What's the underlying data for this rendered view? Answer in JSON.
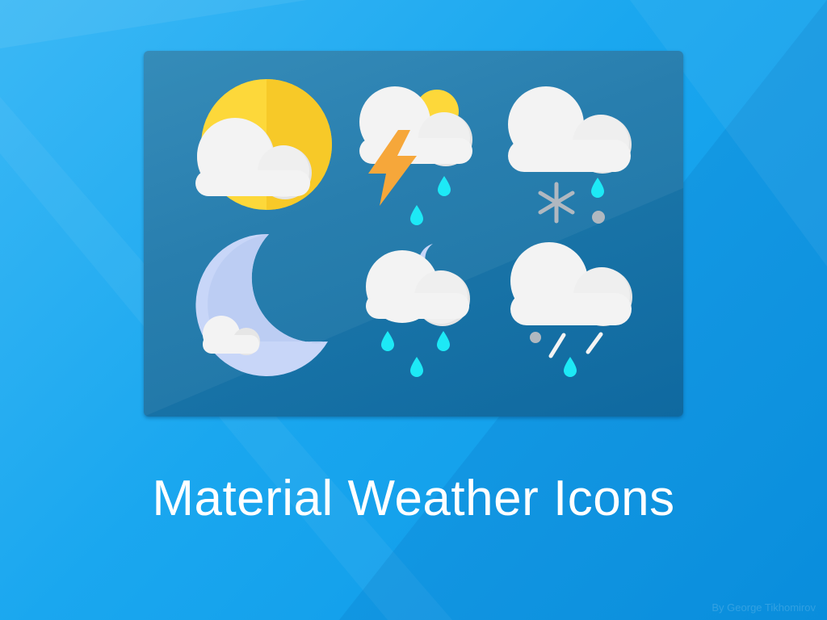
{
  "title": "Material Weather Icons",
  "credit": "By George Tikhomirov",
  "icons": [
    {
      "name": "partly-cloudy-day-icon"
    },
    {
      "name": "thunderstorm-rain-icon"
    },
    {
      "name": "snow-rain-icon"
    },
    {
      "name": "partly-cloudy-night-icon"
    },
    {
      "name": "night-rain-icon"
    },
    {
      "name": "sleet-icon"
    }
  ],
  "colors": {
    "background": "#1aa7ef",
    "panel": "#1d78aa",
    "sun": "#fdd83a",
    "cloud": "#f2f2f2",
    "rain": "#1de9f6",
    "lightning": "#f6a73a",
    "moon": "#c8d6f8",
    "snow": "#b0b8c0",
    "title": "#ffffff"
  }
}
